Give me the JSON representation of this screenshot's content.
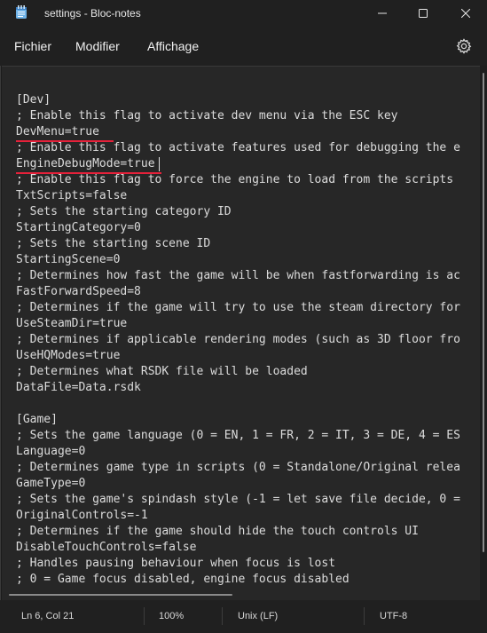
{
  "window": {
    "title": "settings - Bloc-notes"
  },
  "menu": {
    "file": "Fichier",
    "edit": "Modifier",
    "view": "Affichage"
  },
  "editor": {
    "lines": [
      "",
      "[Dev]",
      "; Enable this flag to activate dev menu via the ESC key",
      "DevMenu=true",
      "; Enable this flag to activate features used for debugging the e",
      "EngineDebugMode=true",
      "; Enable this flag to force the engine to load from the scripts",
      "TxtScripts=false",
      "; Sets the starting category ID",
      "StartingCategory=0",
      "; Sets the starting scene ID",
      "StartingScene=0",
      "; Determines how fast the game will be when fastforwarding is ac",
      "FastForwardSpeed=8",
      "; Determines if the game will try to use the steam directory for",
      "UseSteamDir=true",
      "; Determines if applicable rendering modes (such as 3D floor fro",
      "UseHQModes=true",
      "; Determines what RSDK file will be loaded",
      "DataFile=Data.rsdk",
      "",
      "[Game]",
      "; Sets the game language (0 = EN, 1 = FR, 2 = IT, 3 = DE, 4 = ES",
      "Language=0",
      "; Determines game type in scripts (0 = Standalone/Original relea",
      "GameType=0",
      "; Sets the game's spindash style (-1 = let save file decide, 0 =",
      "OriginalControls=-1",
      "; Determines if the game should hide the touch controls UI",
      "DisableTouchControls=false",
      "; Handles pausing behaviour when focus is lost",
      "; 0 = Game focus disabled, engine focus disabled"
    ]
  },
  "statusbar": {
    "position": "Ln 6, Col 21",
    "zoom": "100%",
    "line_endings": "Unix (LF)",
    "encoding": "UTF-8"
  },
  "colors": {
    "background": "#1c1c1c",
    "editor_bg": "#272727",
    "text": "#dcdcdc",
    "highlight_underline": "#e5213a"
  }
}
